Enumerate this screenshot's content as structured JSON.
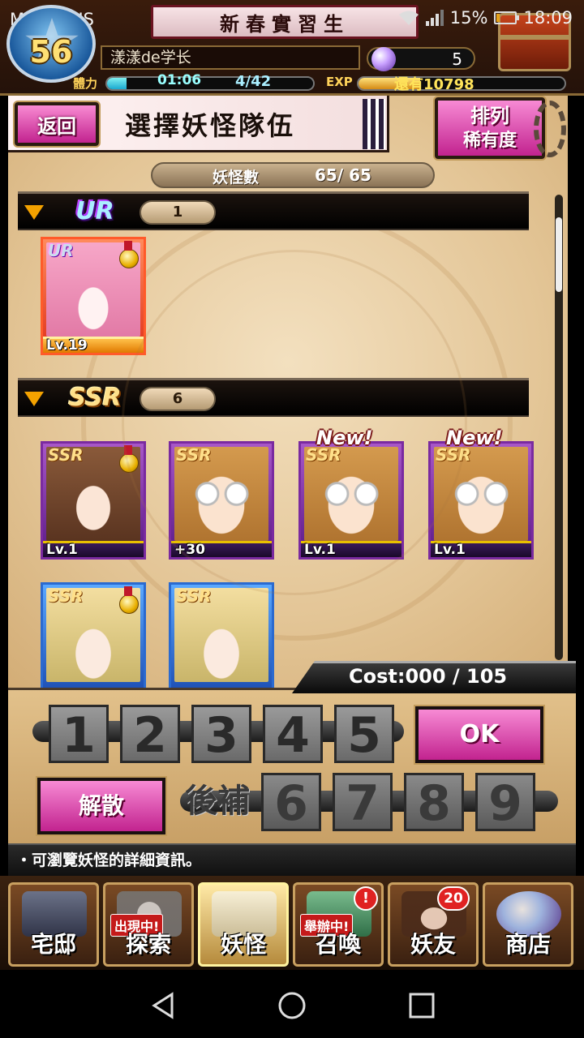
{
  "status_bar": {
    "carrier": "MY MAXIS",
    "battery": "15%",
    "time": "18:09"
  },
  "header": {
    "level": "56",
    "title": "新春實習生",
    "player_name": "漾漾de学长",
    "gems": "5",
    "stamina_label": "體力",
    "stamina_timer": "01:06",
    "stamina_value": "4/42",
    "stamina_fraction": 0.095,
    "exp_label": "EXP",
    "exp_remaining": "還有10798",
    "exp_fraction": 0.3
  },
  "screen": {
    "back_label": "返回",
    "title": "選擇妖怪隊伍",
    "sort_label": "排列",
    "sort_value": "稀有度",
    "count_label": "妖怪數",
    "count_value": "65/ 65"
  },
  "groups": [
    {
      "rarity": "UR",
      "count": "1",
      "cards": [
        {
          "rarity": "UR",
          "level": "Lv.19",
          "medal": true,
          "new": false
        }
      ]
    },
    {
      "rarity": "SSR",
      "count": "6",
      "cards": [
        {
          "rarity": "SSR",
          "level": "Lv.1",
          "medal": true,
          "new": false
        },
        {
          "rarity": "SSR",
          "level": "+30",
          "medal": false,
          "new": false
        },
        {
          "rarity": "SSR",
          "level": "Lv.1",
          "medal": false,
          "new": true
        },
        {
          "rarity": "SSR",
          "level": "Lv.1",
          "medal": false,
          "new": true
        },
        {
          "rarity": "SSR",
          "level": "",
          "medal": true,
          "new": false
        },
        {
          "rarity": "SSR",
          "level": "",
          "medal": false,
          "new": false
        }
      ]
    }
  ],
  "new_label": "New!",
  "team": {
    "cost": "Cost:000 / 105",
    "slots_main": [
      "1",
      "2",
      "3",
      "4",
      "5"
    ],
    "slots_reserve": [
      "6",
      "7",
      "8",
      "9"
    ],
    "reserve_label": "後補",
    "ok_label": "OK",
    "disband_label": "解散"
  },
  "hint": "・可瀏覽妖怪的詳細資訊。",
  "nav": {
    "items": [
      {
        "label": "宅邸"
      },
      {
        "label": "探索",
        "tag": "出現中!"
      },
      {
        "label": "妖怪"
      },
      {
        "label": "召喚",
        "tag": "舉辦中!",
        "notif": "!"
      },
      {
        "label": "妖友",
        "badge": "20"
      },
      {
        "label": "商店"
      }
    ]
  },
  "colors": {
    "accent_pink": "#c2238f",
    "gold": "#e9c000",
    "ur_card": "#e0331a",
    "ssr_card": "#5a1a86"
  }
}
